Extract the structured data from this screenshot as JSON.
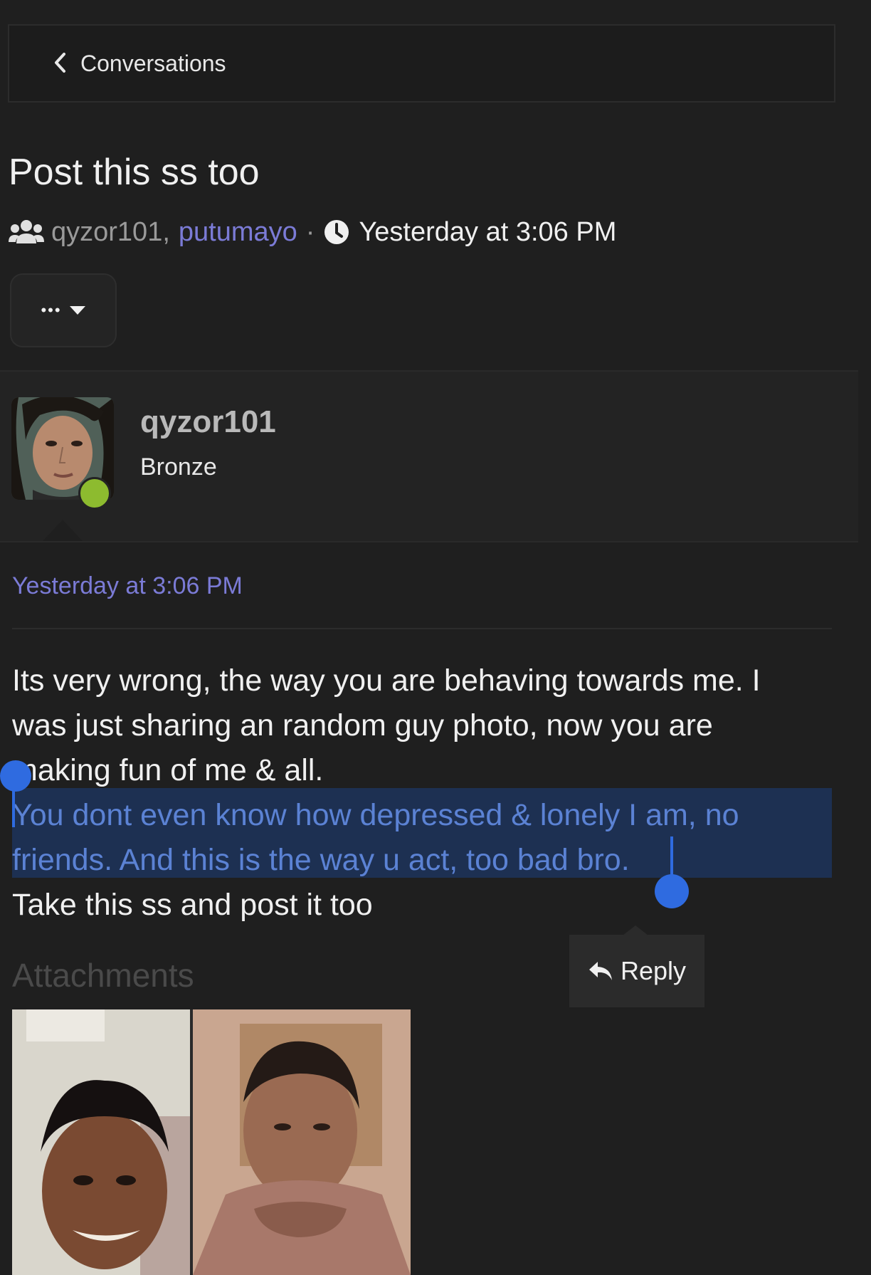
{
  "nav": {
    "back_label": "Conversations"
  },
  "conversation": {
    "title": "Post this ss too",
    "participant_1": "qyzor101",
    "participant_sep": ",",
    "participant_2": "putumayo",
    "dot": "·",
    "started": "Yesterday at 3:06 PM"
  },
  "menu": {
    "dots": "•••"
  },
  "author": {
    "name": "qyzor101",
    "rank": "Bronze"
  },
  "message": {
    "time": "Yesterday at 3:06 PM",
    "line1": "Its very wrong, the way you are behaving towards me. I",
    "line2": "was just sharing an random guy photo, now you are",
    "line3": "making fun of me & all.",
    "line4": "You dont even know how depressed & lonely I am, no",
    "line5": "friends. And this is the way u act, too bad bro.",
    "line6": "Take this ss and post it too"
  },
  "reply": {
    "label": "Reply"
  },
  "attachments": {
    "heading": "Attachments"
  },
  "colors": {
    "background": "#1f1f1f",
    "link": "#7b7bd6",
    "selection": "#1d3052",
    "handle": "#2f6be0",
    "online": "#8dbb2f"
  }
}
